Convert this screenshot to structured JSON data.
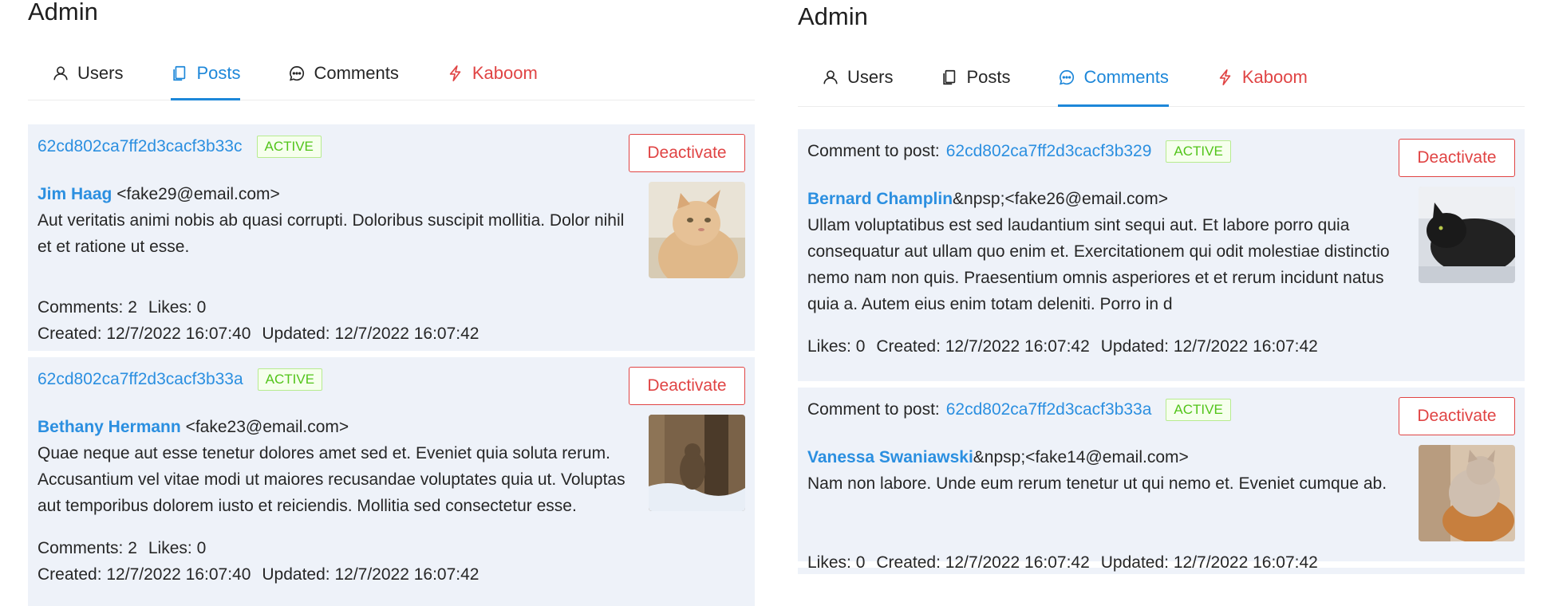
{
  "left": {
    "title": "Admin",
    "tabs": [
      {
        "label": "Users",
        "icon": "user-icon",
        "state": "normal"
      },
      {
        "label": "Posts",
        "icon": "copy-icon",
        "state": "active"
      },
      {
        "label": "Comments",
        "icon": "message-icon",
        "state": "normal"
      },
      {
        "label": "Kaboom",
        "icon": "lightning-icon",
        "state": "danger"
      }
    ],
    "posts": [
      {
        "id": "62cd802ca7ff2d3cacf3b33c",
        "status": "ACTIVE",
        "action": "Deactivate",
        "author": "Jim Haag",
        "email": "<fake29@email.com>",
        "content": "Aut veritatis animi nobis ab quasi corrupti. Doloribus suscipit mollitia. Dolor nihil et et ratione ut esse.",
        "comments": "Comments: 2",
        "likes": "Likes: 0",
        "created": "Created: 12/7/2022 16:07:40",
        "updated": "Updated: 12/7/2022 16:07:42"
      },
      {
        "id": "62cd802ca7ff2d3cacf3b33a",
        "status": "ACTIVE",
        "action": "Deactivate",
        "author": "Bethany Hermann",
        "email": "<fake23@email.com>",
        "content": "Quae neque aut esse tenetur dolores amet sed et. Eveniet quia soluta rerum. Accusantium vel vitae modi ut maiores recusandae voluptates quia ut. Voluptas aut temporibus dolorem iusto et reiciendis. Mollitia sed consectetur esse.",
        "comments": "Comments: 2",
        "likes": "Likes: 0",
        "created": "Created: 12/7/2022 16:07:40",
        "updated": "Updated: 12/7/2022 16:07:42"
      }
    ]
  },
  "right": {
    "title": "Admin",
    "tabs": [
      {
        "label": "Users",
        "icon": "user-icon",
        "state": "normal"
      },
      {
        "label": "Posts",
        "icon": "copy-icon",
        "state": "normal"
      },
      {
        "label": "Comments",
        "icon": "message-icon",
        "state": "active"
      },
      {
        "label": "Kaboom",
        "icon": "lightning-icon",
        "state": "danger"
      }
    ],
    "comments": [
      {
        "prefix": "Comment to post:",
        "post_id": "62cd802ca7ff2d3cacf3b329",
        "status": "ACTIVE",
        "action": "Deactivate",
        "author": "Bernard Champlin",
        "email": "&npsp;<fake26@email.com>",
        "content": "Ullam voluptatibus est sed laudantium sint sequi aut. Et labore porro quia consequatur aut ullam quo enim et. Exercitationem qui odit molestiae distinctio nemo nam non quis. Praesentium omnis asperiores et et rerum incidunt natus quia a. Autem eius enim totam deleniti. Porro in d",
        "likes": "Likes: 0",
        "created": "Created: 12/7/2022 16:07:42",
        "updated": "Updated: 12/7/2022 16:07:42"
      },
      {
        "prefix": "Comment to post:",
        "post_id": "62cd802ca7ff2d3cacf3b33a",
        "status": "ACTIVE",
        "action": "Deactivate",
        "author": "Vanessa Swaniawski",
        "email": "&npsp;<fake14@email.com>",
        "content": "Nam non labore. Unde eum rerum tenetur ut qui nemo et. Eveniet cumque ab.",
        "likes": "Likes: 0",
        "created": "Created: 12/7/2022 16:07:42",
        "updated": "Updated: 12/7/2022 16:07:42"
      }
    ]
  },
  "colors": {
    "primary": "#1d87d9",
    "danger": "#e04444",
    "success": "#52c41a",
    "card_bg": "#eef2f9"
  }
}
